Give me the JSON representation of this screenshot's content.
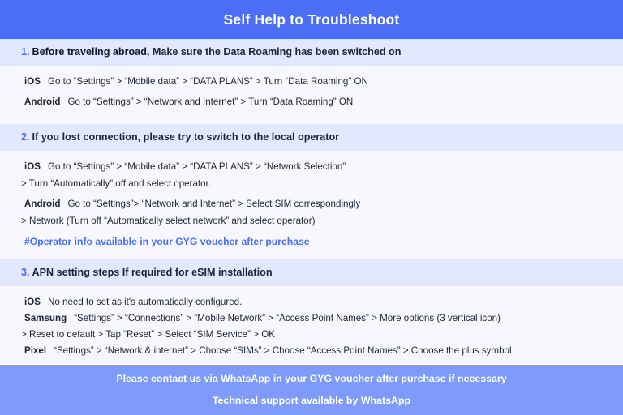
{
  "header": {
    "title": "Self Help to Troubleshoot",
    "bg_color": "#4c6ef5",
    "text_color": "#ffffff"
  },
  "theme": {
    "page_bg": "#f7f7fd",
    "band_bg": "#e2e8fd",
    "accent_blue": "#4c6ef5",
    "footer_bg": "#7f9bfa",
    "body_text": "#1d2433"
  },
  "sections": [
    {
      "number": "1.",
      "title_lead": "Before traveling abroad,",
      "title_rest": " Make sure the Data Roaming has been switched on",
      "rows": [
        {
          "os": "iOS",
          "text": "Go to “Settings” > “Mobile data” > “DATA PLANS” > Turn “Data Roaming” ON"
        },
        {
          "os": "Android",
          "text": "Go to “Settings” > “Network and Internet” > Turn “Data Roaming” ON"
        }
      ]
    },
    {
      "number": "2.",
      "title_lead": "If you lost connection, please try to switch to the local operator",
      "title_rest": "",
      "rows": [
        {
          "os": "iOS",
          "text": "Go to “Settings” > “Mobile data” > “DATA PLANS” > “Network Selection”",
          "continuation": "> Turn “Automatically” off and select operator."
        },
        {
          "os": "Android",
          "text": "Go to “Settings”>  “Network and Internet” > Select SIM correspondingly",
          "continuation": "> Network (Turn off “Automatically select network” and select operator)"
        }
      ],
      "note": "#Operator info available in your GYG voucher after purchase"
    },
    {
      "number": "3.",
      "title_lead": "APN setting steps If required for eSIM installation",
      "title_rest": "",
      "rows": [
        {
          "os": "iOS",
          "text": "No need to set as it's automatically configured."
        },
        {
          "os": "Samsung",
          "text": "“Settings” > “Connections” > “Mobile Network” > “Access Point Names” > More options (3 vertical icon)",
          "continuation": "> Reset to default > Tap “Reset” > Select “SIM Service” > OK"
        },
        {
          "os": "Pixel",
          "text": "“Settings” > “Network & internet” > Choose “SIMs” > Choose “Access Point Names” > Choose the plus symbol."
        }
      ]
    }
  ],
  "footer": {
    "line1": "Please contact us via WhatsApp  in your GYG voucher after purchase if necessary",
    "line2": "Technical support available by WhatsApp"
  }
}
